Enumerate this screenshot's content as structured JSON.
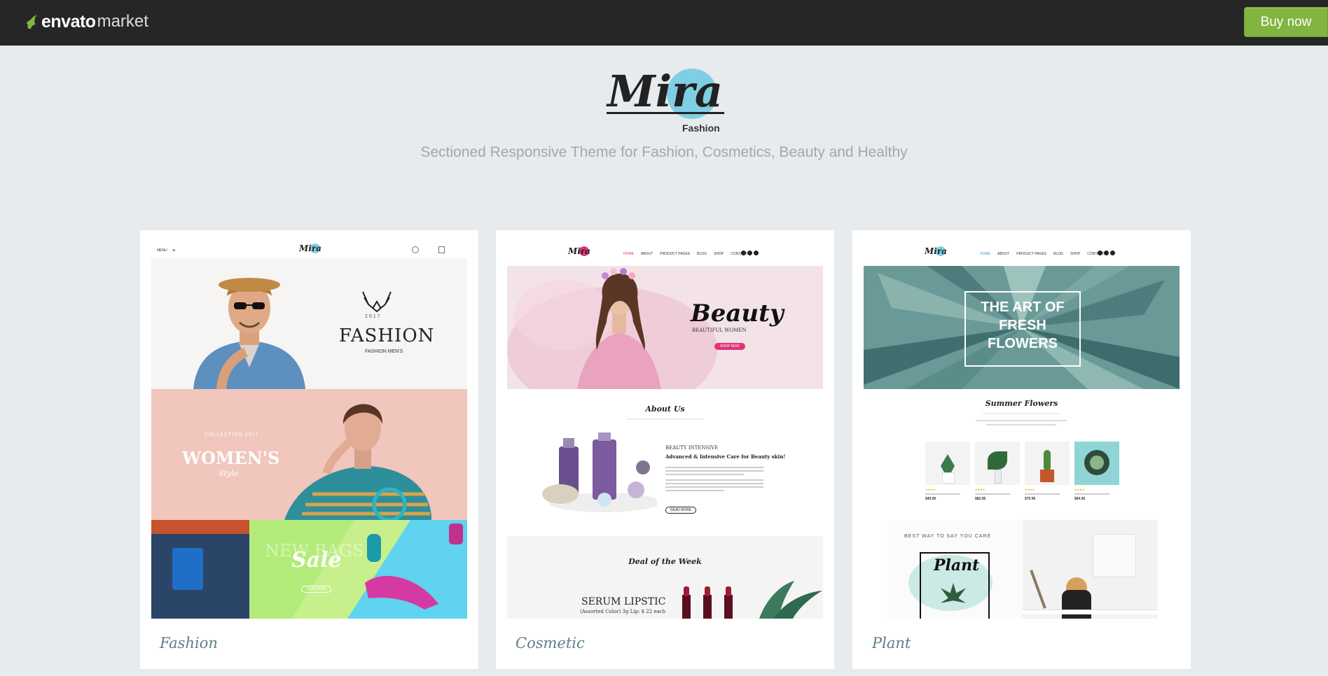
{
  "topbar": {
    "brand": "envato",
    "market": "market",
    "buy_label": "Buy now",
    "accent": "#82b540"
  },
  "hero": {
    "logo_text": "Mira",
    "logo_sub": "Fashion",
    "tagline": "Sectioned Responsive Theme for Fashion, Cosmetics, Beauty and Healthy"
  },
  "cards": [
    {
      "label": "Fashion",
      "preview": {
        "menu": "MENU",
        "banner1_title": "FASHION",
        "banner1_year": "2017",
        "banner1_sub": "FASHION MEN'S",
        "banner2_small": "COLLECTION 2017",
        "banner2_title": "WOMEN'S",
        "banner2_sub": "Style",
        "banner3_bg": "NEW BAGS",
        "banner3_title": "Sale",
        "banner3_btn": "VIEW MORE"
      }
    },
    {
      "label": "Cosmetic",
      "preview": {
        "nav": [
          "HOME",
          "ABOUT",
          "PRODUCT PAGES",
          "BLOG",
          "SHOP",
          "CONTACT"
        ],
        "hero_title": "Beauty",
        "hero_sub": "BEAUTIFUL WOMEN",
        "hero_btn": "SHOP NOW",
        "about_title": "About Us",
        "intensive": "BEAUTY INTENSIVE",
        "intensive_title": "Advanced & Intensive Care for Beauty skin!",
        "read_more": "READ MORE",
        "deal_title": "Deal of the Week",
        "serum_title": "SERUM LIPSTIC",
        "serum_sub": "(Assorted Color) 3g Lip: $ 22 each"
      }
    },
    {
      "label": "Plant",
      "preview": {
        "nav": [
          "HOME",
          "ABOUT",
          "PRODUCT PAGES",
          "BLOG",
          "SHOP",
          "CONTACT"
        ],
        "hero_lines": [
          "THE ART OF",
          "FRESH",
          "FLOWERS"
        ],
        "section_title": "Summer Flowers",
        "prices": [
          "$49.95",
          "$82.95",
          "$70.95",
          "$64.95"
        ],
        "promo_small": "BEST WAY TO SAY YOU CARE",
        "promo_title": "Plant"
      }
    }
  ]
}
